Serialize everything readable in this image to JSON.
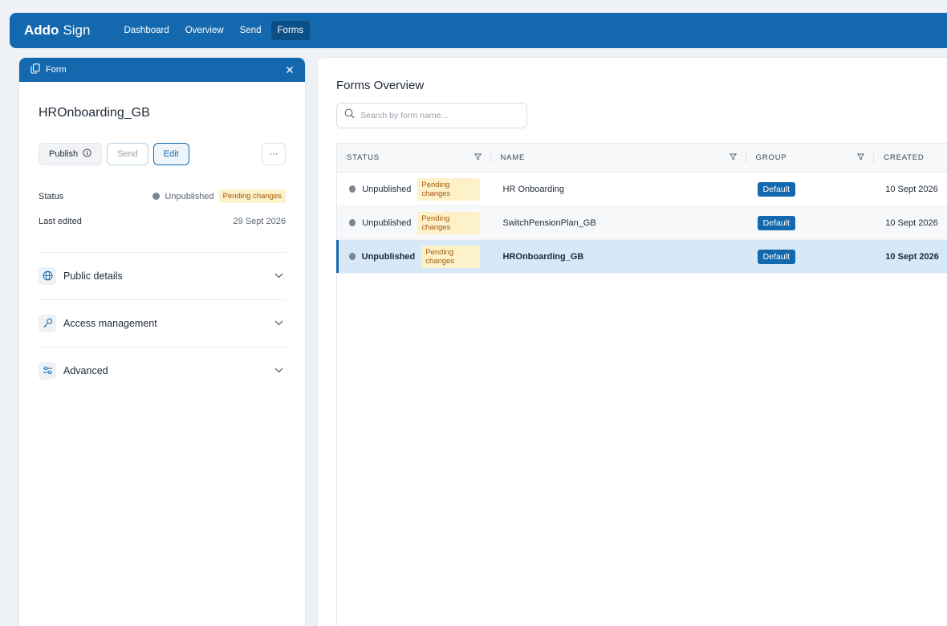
{
  "app": {
    "brand_bold": "Addo",
    "brand_light": "Sign"
  },
  "nav": [
    {
      "label": "Dashboard",
      "active": false
    },
    {
      "label": "Overview",
      "active": false
    },
    {
      "label": "Send",
      "active": false
    },
    {
      "label": "Forms",
      "active": true
    }
  ],
  "panel": {
    "header": "Form",
    "title": "HROnboarding_GB",
    "buttons": {
      "publish": "Publish",
      "send": "Send",
      "edit": "Edit",
      "more": "···"
    },
    "status_label": "Status",
    "status_value": "Unpublished",
    "status_badge": "Pending changes",
    "last_edited_label": "Last edited",
    "last_edited_value": "29 Sept 2026",
    "sections": [
      {
        "label": "Public details",
        "icon": "globe-icon"
      },
      {
        "label": "Access management",
        "icon": "key-icon"
      },
      {
        "label": "Advanced",
        "icon": "sliders-icon"
      }
    ]
  },
  "main": {
    "title": "Forms Overview",
    "search_placeholder": "Search by form name...",
    "columns": {
      "status": "STATUS",
      "name": "NAME",
      "group": "GROUP",
      "created": "CREATED"
    },
    "rows": [
      {
        "status": "Unpublished",
        "badge": "Pending changes",
        "name": "HR Onboarding",
        "group": "Default",
        "created": "10 Sept 2026"
      },
      {
        "status": "Unpublished",
        "badge": "Pending changes",
        "name": "SwitchPensionPlan_GB",
        "group": "Default",
        "created": "10 Sept 2026"
      },
      {
        "status": "Unpublished",
        "badge": "Pending changes",
        "name": "HROnboarding_GB",
        "group": "Default",
        "created": "10 Sept 2026"
      }
    ]
  },
  "colors": {
    "primary": "#1468ad",
    "pending_bg": "#fdf1c9",
    "pending_text": "#a25a0e",
    "selected_row": "#d7e8f6"
  }
}
